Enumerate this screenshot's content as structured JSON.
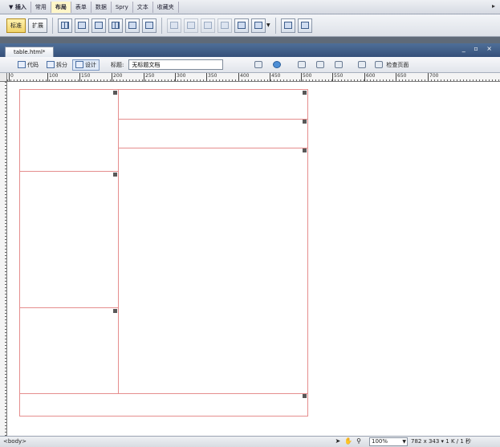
{
  "insert_bar": {
    "tabs": [
      {
        "label": "▼ 插入",
        "state": "menu"
      },
      {
        "label": "常用",
        "state": "normal"
      },
      {
        "label": "布局",
        "state": "normal"
      },
      {
        "label": "表单",
        "state": "normal"
      },
      {
        "label": "数据",
        "state": "normal"
      },
      {
        "label": "Spry",
        "state": "normal"
      },
      {
        "label": "文本",
        "state": "normal"
      },
      {
        "label": "收藏夹",
        "state": "normal"
      }
    ],
    "mode_buttons": [
      "标准",
      "扩展"
    ],
    "tool_icons": [
      "table-icon",
      "div-icon",
      "layer-icon",
      "layout-table-icon",
      "draw-cell-icon",
      "frames-icon",
      "row-above-icon",
      "row-below-icon",
      "col-left-icon",
      "col-right-icon",
      "iframe-icon",
      "frameset-icon",
      "layout-mode-icon"
    ]
  },
  "document": {
    "tab_label": "table.html*",
    "window_controls": "_ ▫ ×"
  },
  "doc_toolbar": {
    "code_label": "代码",
    "split_label": "拆分",
    "design_label": "设计",
    "title_label": "标题:",
    "title_value": "无标题文档",
    "check_page_label": "检查页面"
  },
  "ruler": {
    "marks": [
      "0",
      "100",
      "150",
      "200",
      "250",
      "300",
      "350",
      "400",
      "450",
      "500",
      "550",
      "600",
      "650",
      "700"
    ]
  },
  "status": {
    "tag_selector": "<body>",
    "zoom": "100%",
    "dimensions": "782 x 343 ▾ 1 K / 1 秒"
  },
  "colors": {
    "cell_border": "#e58d8d",
    "doc_tabbar": "#35507a",
    "marker": "#595959"
  }
}
